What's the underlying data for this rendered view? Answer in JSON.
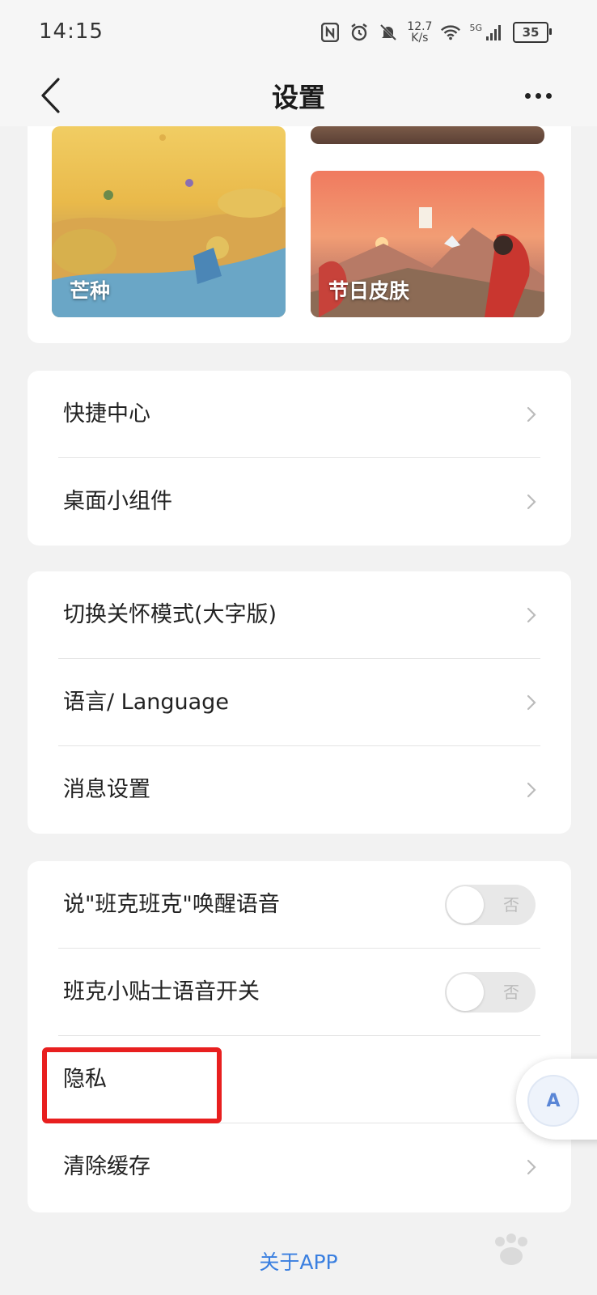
{
  "status_bar": {
    "time": "14:15",
    "net_speed_value": "12.7",
    "net_speed_unit": "K/s",
    "network": "5G",
    "battery": "35"
  },
  "nav": {
    "title": "设置",
    "back_icon": "chevron-left-icon",
    "more_icon": "more-dots-icon"
  },
  "skins": {
    "tiles": [
      {
        "label": "芒种"
      },
      {
        "label": "节日皮肤"
      }
    ]
  },
  "group1": {
    "items": [
      {
        "label": "快捷中心"
      },
      {
        "label": "桌面小组件"
      }
    ]
  },
  "group2": {
    "items": [
      {
        "label": "切换关怀模式(大字版)"
      },
      {
        "label": "语言/ Language"
      },
      {
        "label": "消息设置"
      }
    ]
  },
  "group3": {
    "items": [
      {
        "label": "说\"班克班克\"唤醒语音",
        "toggle": "否"
      },
      {
        "label": "班克小贴士语音开关",
        "toggle": "否"
      },
      {
        "label": "隐私"
      },
      {
        "label": "清除缓存"
      }
    ]
  },
  "footer": {
    "about": "关于APP"
  },
  "colors": {
    "accent": "#3a7fe0",
    "highlight": "#e81f1f",
    "background": "#f2f2f2"
  }
}
